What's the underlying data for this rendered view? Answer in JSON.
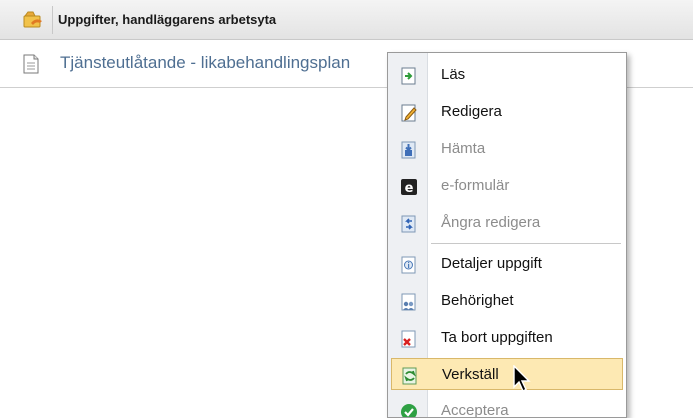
{
  "window": {
    "title": "Uppgifter, handläggarens arbetsyta",
    "app_icon": "hand-folder-icon"
  },
  "document": {
    "title": "Tjänsteutlåtande - likabehandlingsplan",
    "icon": "document-icon"
  },
  "context_menu": {
    "items": [
      {
        "label": "Läs",
        "icon": "read-icon",
        "enabled": true
      },
      {
        "label": "Redigera",
        "icon": "edit-icon",
        "enabled": true
      },
      {
        "label": "Hämta",
        "icon": "download-icon",
        "enabled": false
      },
      {
        "label": "e-formulär",
        "icon": "e-form-icon",
        "enabled": false
      },
      {
        "label": "Ångra redigera",
        "icon": "undo-edit-icon",
        "enabled": false
      },
      {
        "label": "Detaljer uppgift",
        "icon": "details-icon",
        "enabled": true
      },
      {
        "label": "Behörighet",
        "icon": "permissions-icon",
        "enabled": true
      },
      {
        "label": "Ta bort uppgiften",
        "icon": "delete-task-icon",
        "enabled": true
      },
      {
        "label": "Verkställ",
        "icon": "execute-icon",
        "enabled": true,
        "highlighted": true
      },
      {
        "label": "Acceptera",
        "icon": "accept-icon",
        "enabled": false
      }
    ]
  },
  "colors": {
    "highlight": "#fde9b3",
    "doc_title": "#4f6f92",
    "disabled_text": "#8c8c8c"
  }
}
